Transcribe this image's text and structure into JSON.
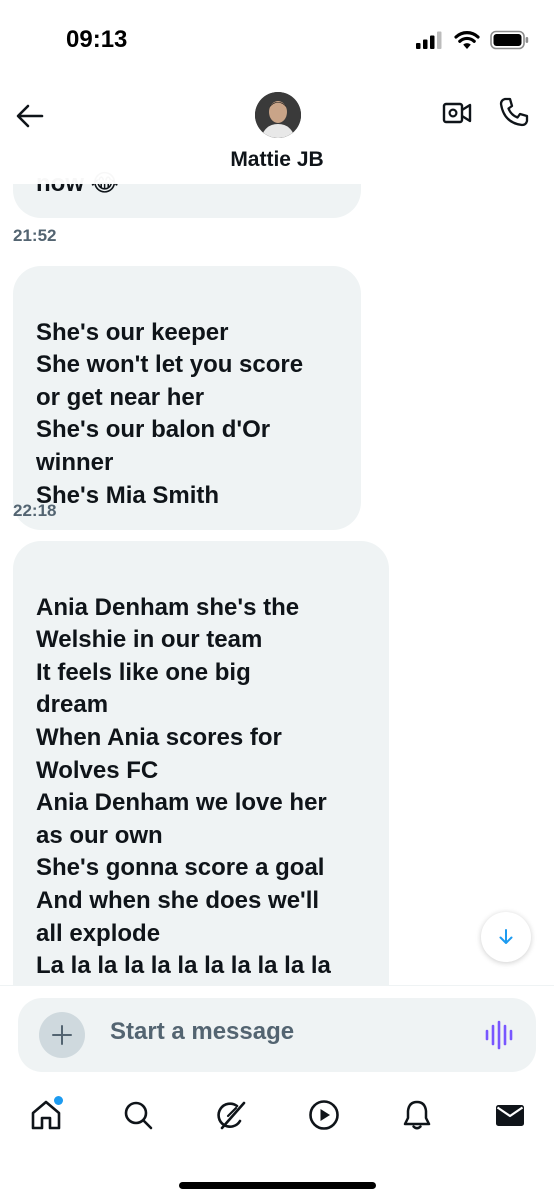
{
  "status_bar": {
    "time": "09:13"
  },
  "header": {
    "contact_name": "Mattie JB"
  },
  "messages": [
    {
      "text": "now 😂"
    },
    {
      "timestamp": "21:52"
    },
    {
      "text": "She's our keeper\nShe won't let you score\nor get near her\nShe's our balon d'Or\nwinner\nShe's Mia Smith"
    },
    {
      "timestamp": "22:18"
    },
    {
      "text": "Ania Denham she's the\nWelshie in our team\nIt feels like one big\ndream\nWhen Ania scores for\nWolves FC\nAnia Denham we love her\nas our own\nShe's gonna score a goal\nAnd when she does we'll\nall explode\nLa la la la la la la la la la la"
    }
  ],
  "composer": {
    "placeholder": "Start a message"
  },
  "colors": {
    "accent": "#1d9bf0",
    "bubble": "#eff3f4",
    "muted": "#536471",
    "voice": "#7856ff"
  },
  "tabbar": {
    "items": [
      "home-icon",
      "search-icon",
      "grok-icon",
      "video-icon",
      "notifications-icon",
      "messages-icon"
    ],
    "home_badge": true
  }
}
